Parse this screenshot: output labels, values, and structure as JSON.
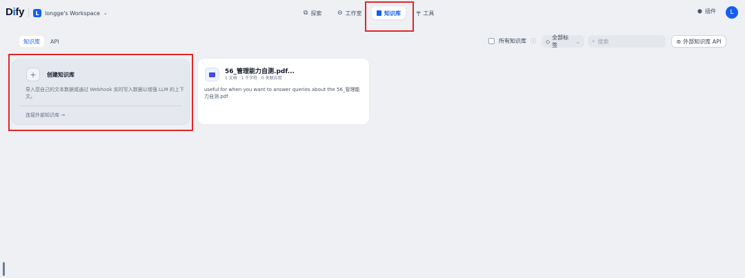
{
  "brand": {
    "logo_prefix": "D",
    "logo_dot": "i",
    "logo_suffix": "fy"
  },
  "workspace": {
    "badge": "L",
    "name": "longge's Workspace",
    "chevron": "⌄"
  },
  "nav": {
    "explore": "探索",
    "studio": "工作室",
    "knowledge": "知识库",
    "tools": "工具"
  },
  "header_right": {
    "plugins": "插件",
    "avatar": "L"
  },
  "tabs": {
    "knowledge": "知识库",
    "api": "API"
  },
  "filters": {
    "all_knowledge_label": "所有知识库",
    "tag_filter": "全部标签",
    "search_placeholder": "搜索",
    "external_api": "外部知识库 API"
  },
  "create_card": {
    "plus": "+",
    "title": "创建知识库",
    "description": "导入您自己的文本数据或通过 Webhook 实时写入数据以增强 LLM 的上下文。",
    "external_link": "连接外部知识库 →"
  },
  "datasets": [
    {
      "name": "56_管理能力自测.pdf...",
      "meta": "1 文档 · 1 千字符 · 0 关联应用",
      "description": "useful for when you want to answer queries about the 56_管理能力自测.pdf"
    }
  ],
  "colors": {
    "accent": "#155eef",
    "highlight": "#e02424",
    "background": "#eef0f4"
  },
  "icons": {
    "explore": "compass-icon",
    "studio": "robot-icon",
    "knowledge": "book-icon",
    "tools": "hammer-icon",
    "plugins": "puzzle-icon",
    "help": "question-circle-icon",
    "tag": "tag-icon",
    "search": "search-icon",
    "api": "api-icon"
  }
}
